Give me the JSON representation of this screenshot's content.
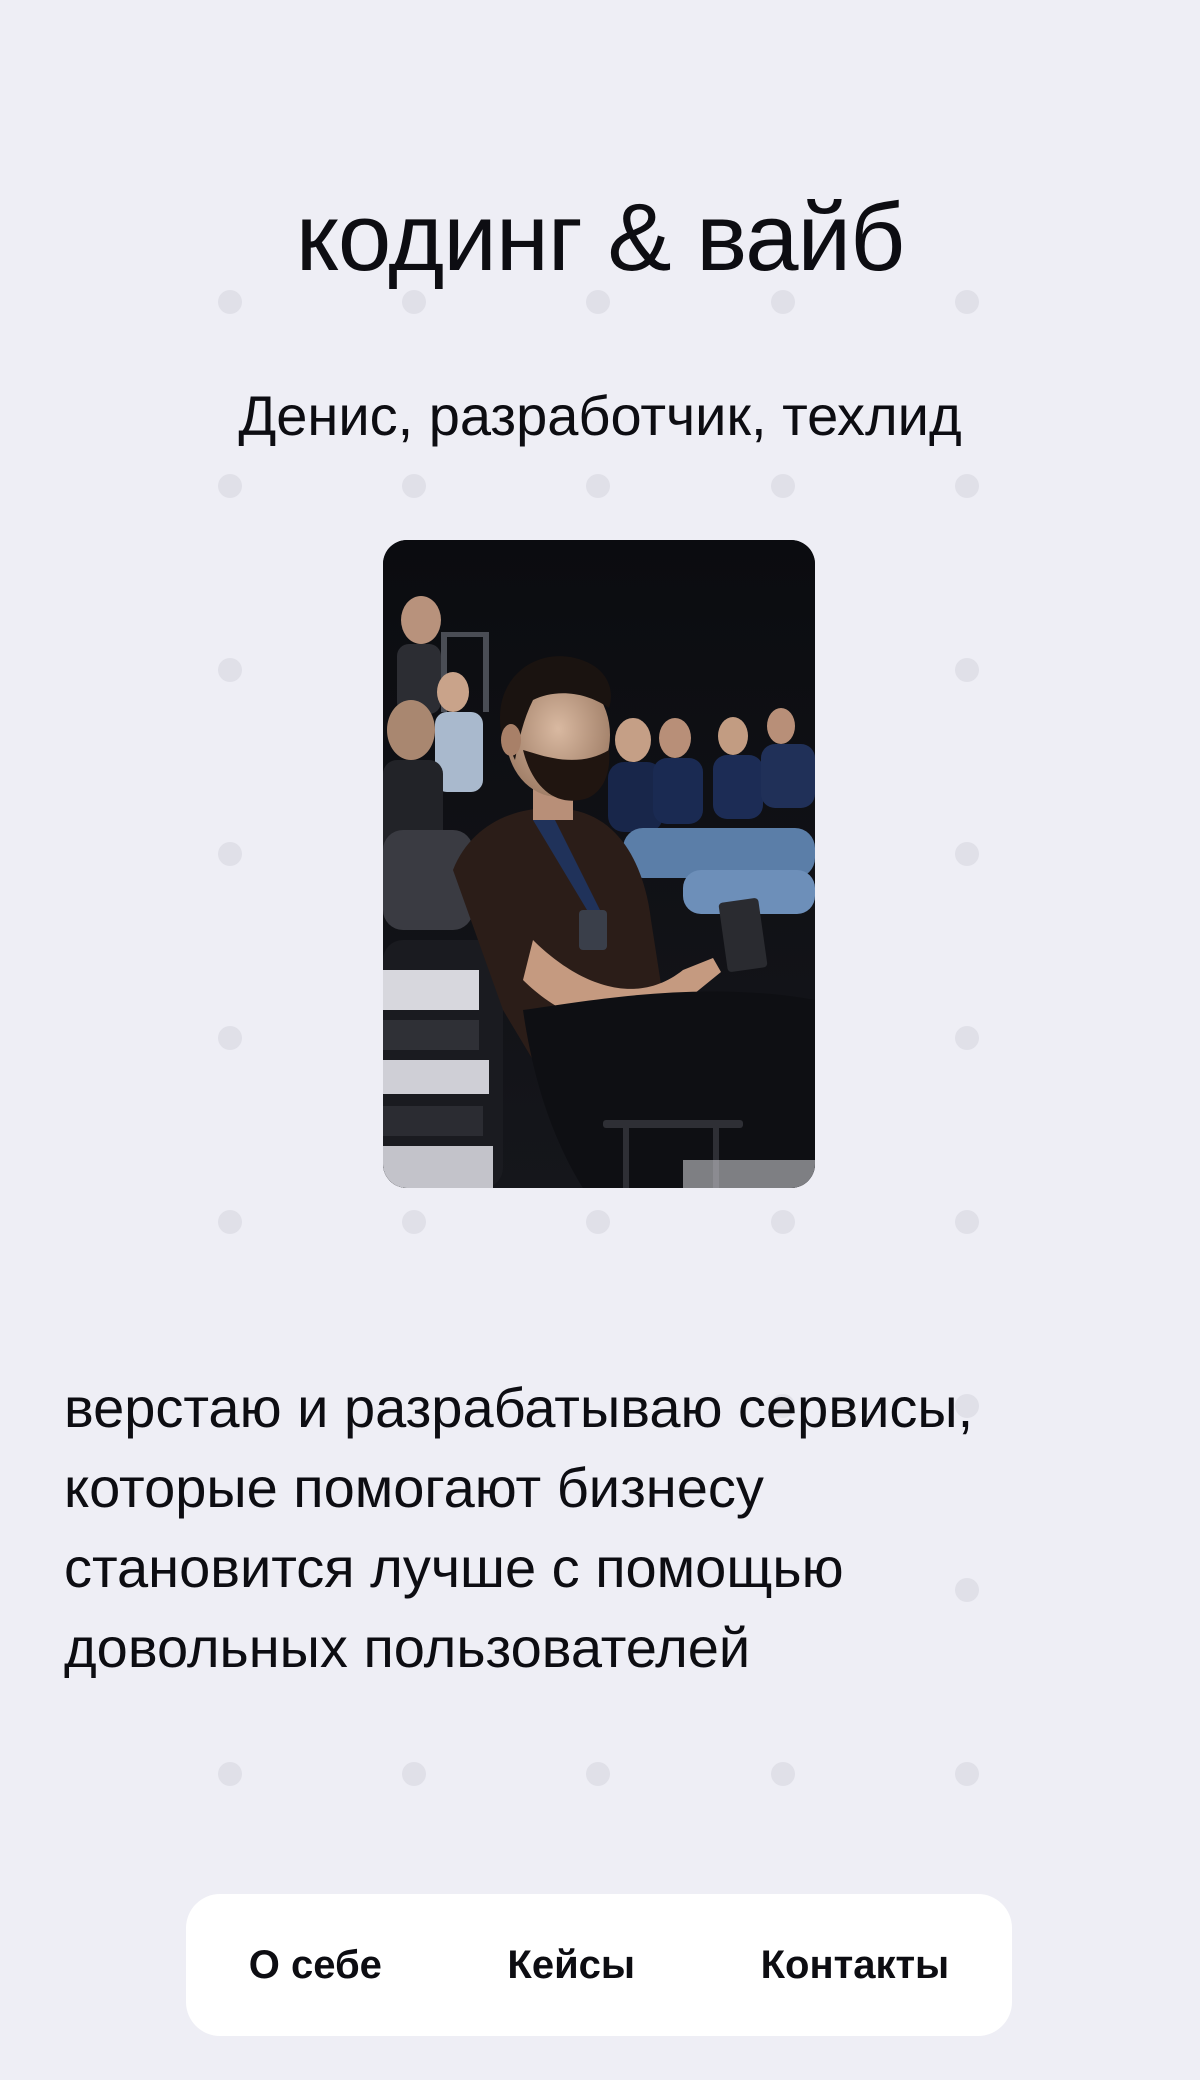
{
  "hero": {
    "title": "кодинг & вайб",
    "subtitle": "Денис, разработчик, техлид"
  },
  "photo": {
    "description": "Мужчина с бородой в тёмной футболке с бейджем сидит в зале среди слушателей конференции"
  },
  "about": {
    "lines": [
      "верстаю и разрабатываю сервисы,",
      "которые помогают бизнесу",
      "становится лучше с помощью",
      "довольных пользователей"
    ]
  },
  "nav": {
    "items": [
      {
        "label": "О себе"
      },
      {
        "label": "Кейсы"
      },
      {
        "label": "Контакты"
      }
    ]
  },
  "colors": {
    "background": "#eeeef5",
    "dot": "#e0e0e8",
    "text": "#0d0d12",
    "nav_background": "#ffffff"
  }
}
